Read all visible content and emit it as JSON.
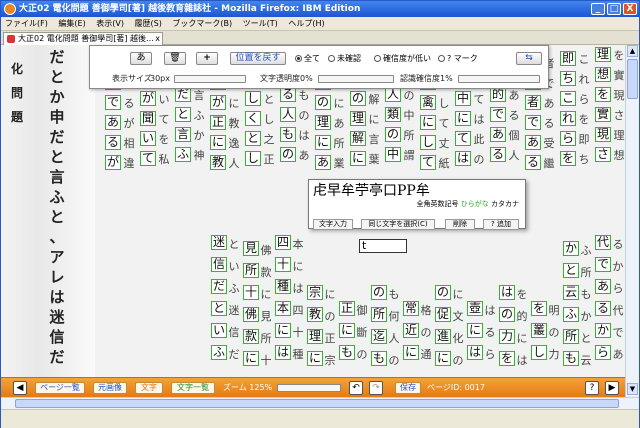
{
  "window": {
    "title": "大正02 電化問題 善御學司[著] 越後教育雜誌社 - Mozilla Firefox: IBM Edition",
    "minimize": "_",
    "maximize": "□",
    "close": "X"
  },
  "menu": [
    "ファイル(F)",
    "編集(E)",
    "表示(V)",
    "履歴(S)",
    "ブックマーク(B)",
    "ツール(T)",
    "ヘルプ(H)"
  ],
  "tab": {
    "label": "大正02 電化問題 善御學司[著] 越後...",
    "close": "x"
  },
  "toolbar": {
    "btn_a": "あ",
    "btn_trash": "🗑",
    "btn_add": "+",
    "restore_position": "位置を戻す",
    "radios": [
      {
        "label": "全て",
        "selected": true
      },
      {
        "label": "未確認",
        "selected": false
      },
      {
        "label": "確信度が低い",
        "selected": false
      },
      {
        "label": "? マーク",
        "selected": false
      }
    ],
    "display_size_label": "表示サイズ",
    "display_size_value": "30px",
    "char_opacity_label": "文字透明度",
    "char_opacity_value": "0%",
    "recog_confidence_label": "認識確信度",
    "recog_confidence_value": "1%",
    "swap_icon": "⇆"
  },
  "left_margin_text": [
    "化問題",
    "だとか申だと言ふと、アレは迷信だ、知"
  ],
  "ime": {
    "candidates": "虍早牟苧亭口PP牟",
    "mode_prefix": "全角英数記号",
    "mode_hiragana": "ひらがな",
    "mode_katakana": "カタカナ",
    "buttons": [
      "文字入力",
      "同じ文字を選択(C)",
      "削除",
      "? 追加"
    ]
  },
  "input_value": "t",
  "bottom": {
    "page_list": "ページ一覧",
    "original": "元画像",
    "text": "文字",
    "text_list": "文字一覧",
    "zoom_label": "ズーム 125%",
    "save": "保存",
    "page_id": "ページID: 0017"
  },
  "status": "",
  "colors": {
    "box_green": "#2db82d",
    "bottom_orange": "#e47a12",
    "title_blue": "#1d55d0"
  },
  "doc_columns": [
    [
      "理",
      "想",
      "を",
      "實",
      "現",
      "さ"
    ],
    [
      "即",
      "ち",
      "こ",
      "れ",
      "ら",
      "を"
    ],
    [
      "受",
      "繼",
      "者",
      "で",
      "あ",
      "る"
    ],
    [
      "個",
      "人",
      "的",
      "で",
      "あ",
      "る"
    ],
    [
      "此",
      "の",
      "中",
      "に",
      "て",
      "は"
    ],
    [
      "丈",
      "紙",
      "禽",
      "に",
      "し",
      "て"
    ],
    [
      "所",
      "謂",
      "人",
      "類",
      "の",
      "中"
    ],
    [
      "言",
      "葉",
      "の",
      "理",
      "解",
      "に"
    ],
    [
      "所",
      "業",
      "の",
      "理",
      "に",
      "あ"
    ],
    [
      "は",
      "あ",
      "る",
      "人",
      "も",
      "の"
    ],
    [
      "之",
      "正",
      "し",
      "く",
      "と",
      "し"
    ],
    [
      "逸",
      "人",
      "が",
      "正",
      "に",
      "教"
    ],
    [
      "か",
      "神",
      "だ",
      "と",
      "言",
      "ふ"
    ],
    [
      "を",
      "私",
      "が",
      "聞",
      "い",
      "て"
    ],
    [
      "相",
      "違",
      "で",
      "あ",
      "る",
      "が"
    ]
  ],
  "doc_columns_lower": [
    [
      "代",
      "で",
      "あ",
      "る",
      "か",
      "ら"
    ],
    [
      "か",
      "と",
      "云",
      "ふ",
      "所",
      "も"
    ],
    [
      "明",
      "の",
      "力",
      "を",
      "叢",
      "し"
    ],
    [
      "的",
      "に",
      "は",
      "の",
      "力",
      "を"
    ],
    [
      "は",
      "る",
      "ら",
      "壺",
      "に",
      "は"
    ],
    [
      "文",
      "化",
      "の",
      "促",
      "進",
      "に"
    ],
    [
      "格",
      "の",
      "通",
      "常",
      "近",
      "に"
    ],
    [
      "何",
      "人",
      "の",
      "所",
      "迄",
      "も"
    ],
    [
      "御",
      "斷",
      "の",
      "正",
      "に",
      "も"
    ],
    [
      "の",
      "正",
      "宗",
      "教",
      "理",
      "に"
    ],
    [
      "四",
      "十",
      "種",
      "本",
      "に",
      "は"
    ],
    [
      "見",
      "所",
      "十",
      "佛",
      "款",
      "に"
    ],
    [
      "迷",
      "信",
      "だ",
      "と",
      "い",
      "ふ"
    ]
  ]
}
